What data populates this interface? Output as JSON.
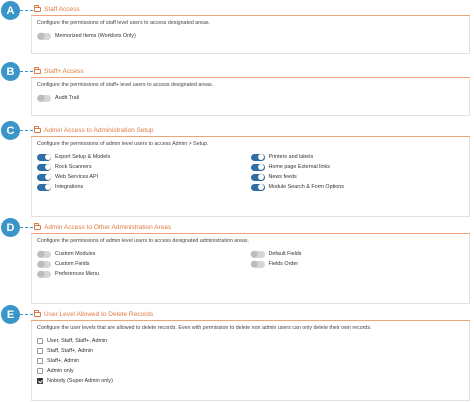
{
  "sections": [
    {
      "badge": "A",
      "title": "Staff Access",
      "description": "Configure the permissions of staff level users to access designated areas.",
      "left": [
        {
          "label": "Memorized Items (Worklists Only)",
          "on": false
        }
      ],
      "right": []
    },
    {
      "badge": "B",
      "title": "Staff+ Access",
      "description": "Configure the permissions of staff+ level users to access designated areas.",
      "left": [
        {
          "label": "Audit Trail",
          "on": false
        }
      ],
      "right": []
    },
    {
      "badge": "C",
      "title": "Admin Access to Administration Setup",
      "description": "Configure the permissions of admin level users to access Admin > Setup.",
      "left": [
        {
          "label": "Export Setup & Models",
          "on": true
        },
        {
          "label": "Rock Scanners",
          "on": true
        },
        {
          "label": "Web Services API",
          "on": true
        },
        {
          "label": "Integrations",
          "on": true
        }
      ],
      "right": [
        {
          "label": "Printers and labels",
          "on": true
        },
        {
          "label": "Home page External links",
          "on": true
        },
        {
          "label": "News feeds",
          "on": true
        },
        {
          "label": "Module Search & Form Options",
          "on": true
        }
      ]
    },
    {
      "badge": "D",
      "title": "Admin Access to Other Administration Areas",
      "description": "Configure the permissions of admin level users to access designated administration areas.",
      "left": [
        {
          "label": "Custom Modules",
          "on": false
        },
        {
          "label": "Custom Fields",
          "on": false
        },
        {
          "label": "Preferences Menu",
          "on": false
        }
      ],
      "right": [
        {
          "label": "Default Fields",
          "on": false
        },
        {
          "label": "Fields Order",
          "on": false
        }
      ]
    }
  ],
  "section_e": {
    "badge": "E",
    "title": "User Level Allowed to Delete Records",
    "description": "Configure the user levels that are allowed to delete records. Even with permission to delete non admin users can only delete their own records.",
    "options": [
      {
        "label": "User, Staff, Staff+, Admin",
        "checked": false
      },
      {
        "label": "Staff, Staff+, Admin",
        "checked": false
      },
      {
        "label": "Staff+, Admin",
        "checked": false
      },
      {
        "label": "Admin only",
        "checked": false
      },
      {
        "label": "Nobody (Super Admin only)",
        "checked": true
      }
    ]
  },
  "colors": {
    "accent": "#e07a45",
    "badge": "#3a95c8",
    "toggle_on": "#2f6fa6",
    "toggle_off": "#d6d6d6"
  },
  "icons": {
    "section_header": "folder-icon"
  }
}
